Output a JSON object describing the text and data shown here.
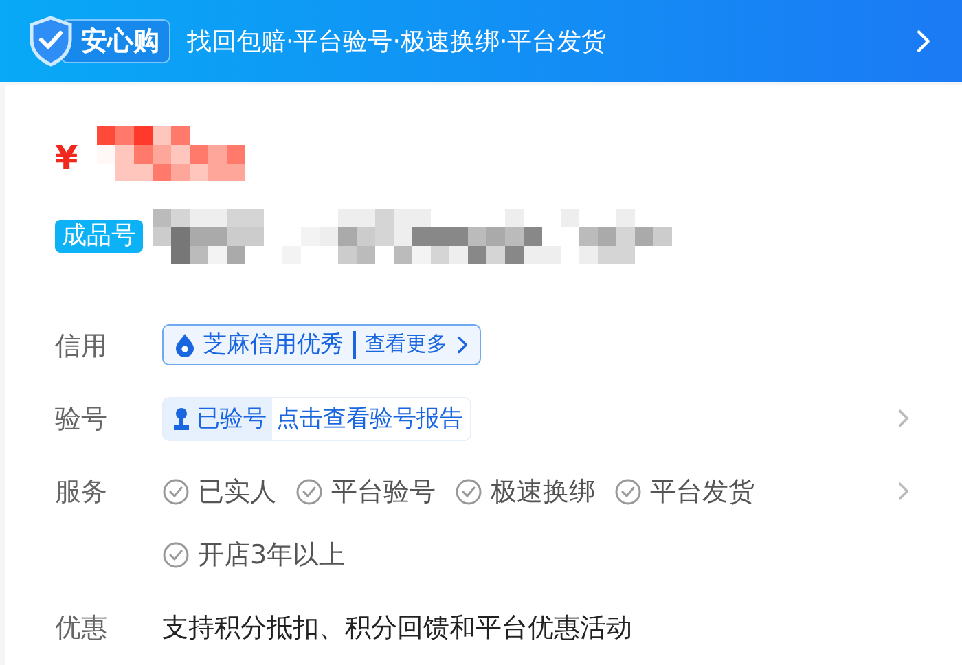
{
  "banner": {
    "badge": "安心购",
    "slogan": "找回包赔·平台验号·极速换绑·平台发货"
  },
  "price": {
    "currency": "¥"
  },
  "product": {
    "tag": "成品号"
  },
  "rows": [
    {
      "kind": "credit",
      "label": "信用",
      "value": "芝麻信用优秀",
      "link": "查看更多",
      "arrow": false
    },
    {
      "kind": "verify",
      "label": "验号",
      "status": "已验号",
      "link": "点击查看验号报告",
      "arrow": true
    },
    {
      "kind": "services",
      "label": "服务",
      "items": [
        "已实人",
        "平台验号",
        "极速换绑",
        "平台发货",
        "开店3年以上"
      ],
      "arrow": true
    },
    {
      "kind": "text",
      "label": "优惠",
      "text": "支持积分抵扣、积分回馈和平台优惠活动",
      "arrow": false
    }
  ]
}
